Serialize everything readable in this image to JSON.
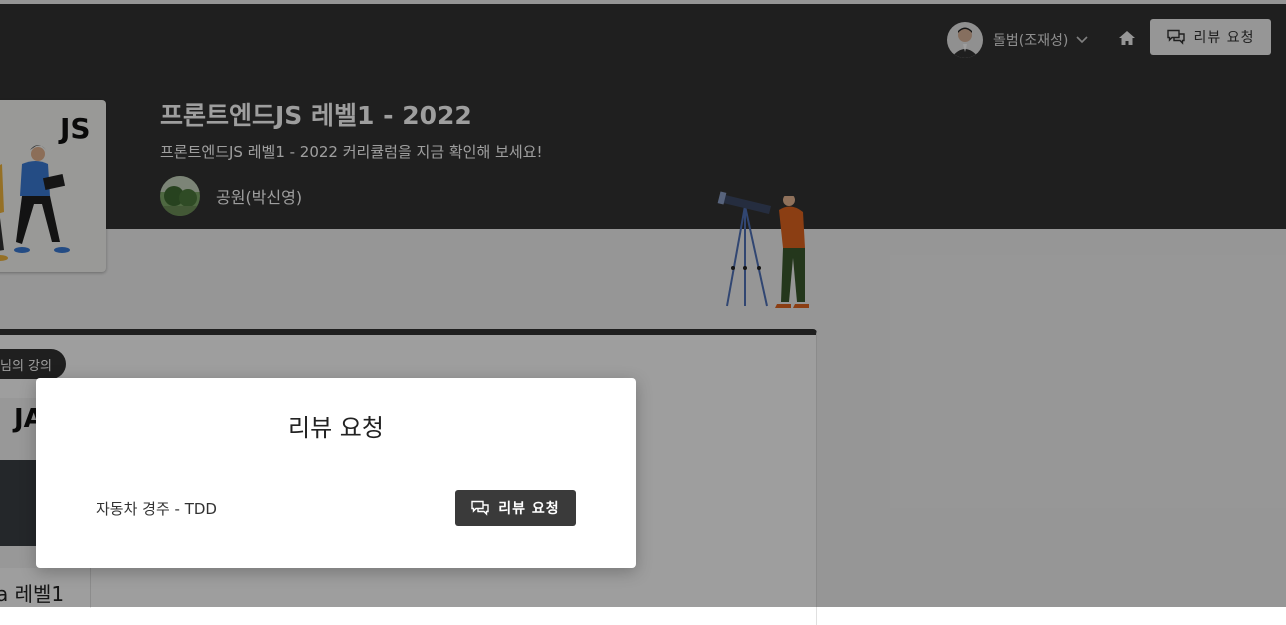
{
  "header": {
    "user_name": "돌범(조재성)",
    "review_request_label": "리뷰 요청",
    "course_title": "프론트엔드JS 레벨1 - 2022",
    "course_description": "프론트엔드JS 레벨1 - 2022 커리큘럼을 지금 확인해 보세요!",
    "instructor_name": "공원(박신영)",
    "thumb_logo": "JS"
  },
  "main": {
    "my_course_badge": "님의 강의",
    "lecture_thumb_logo": "JA",
    "lecture_level": "a 레벨1"
  },
  "modal": {
    "title": "리뷰 요청",
    "item_label": "자동차 경주 - TDD",
    "button_label": "리뷰 요청"
  },
  "icons": {
    "home": "home-icon",
    "chevron": "chevron-down-icon",
    "review": "chat-bubbles-icon"
  },
  "colors": {
    "header_bg": "#333333",
    "button_light": "#f2f2f2",
    "button_dark": "#3a3a3a"
  }
}
